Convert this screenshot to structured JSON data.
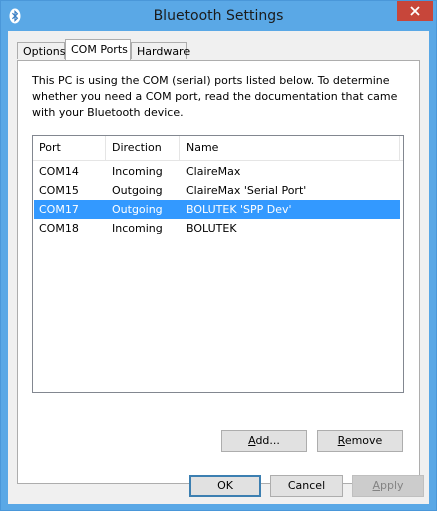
{
  "window": {
    "title": "Bluetooth Settings",
    "accent_color": "#5aa8e6",
    "close_color": "#c7463a"
  },
  "tabs": [
    {
      "label": "Options",
      "selected": false
    },
    {
      "label": "COM Ports",
      "selected": true
    },
    {
      "label": "Hardware",
      "selected": false
    }
  ],
  "description": "This PC is using the COM (serial) ports listed below. To determine whether you need a COM port, read the documentation that came with your Bluetooth device.",
  "table": {
    "columns": [
      "Port",
      "Direction",
      "Name"
    ],
    "rows": [
      {
        "port": "COM14",
        "direction": "Incoming",
        "name": "ClaireMax",
        "selected": false
      },
      {
        "port": "COM15",
        "direction": "Outgoing",
        "name": "ClaireMax 'Serial Port'",
        "selected": false
      },
      {
        "port": "COM17",
        "direction": "Outgoing",
        "name": "BOLUTEK 'SPP Dev'",
        "selected": true
      },
      {
        "port": "COM18",
        "direction": "Incoming",
        "name": "BOLUTEK",
        "selected": false
      }
    ],
    "selection_color": "#3399ff"
  },
  "buttons": {
    "add": {
      "mnemonic": "A",
      "rest": "dd..."
    },
    "remove": {
      "mnemonic": "R",
      "rest": "emove"
    },
    "ok": "OK",
    "cancel": "Cancel",
    "apply": {
      "mnemonic": "A",
      "rest": "pply",
      "disabled": true
    }
  }
}
